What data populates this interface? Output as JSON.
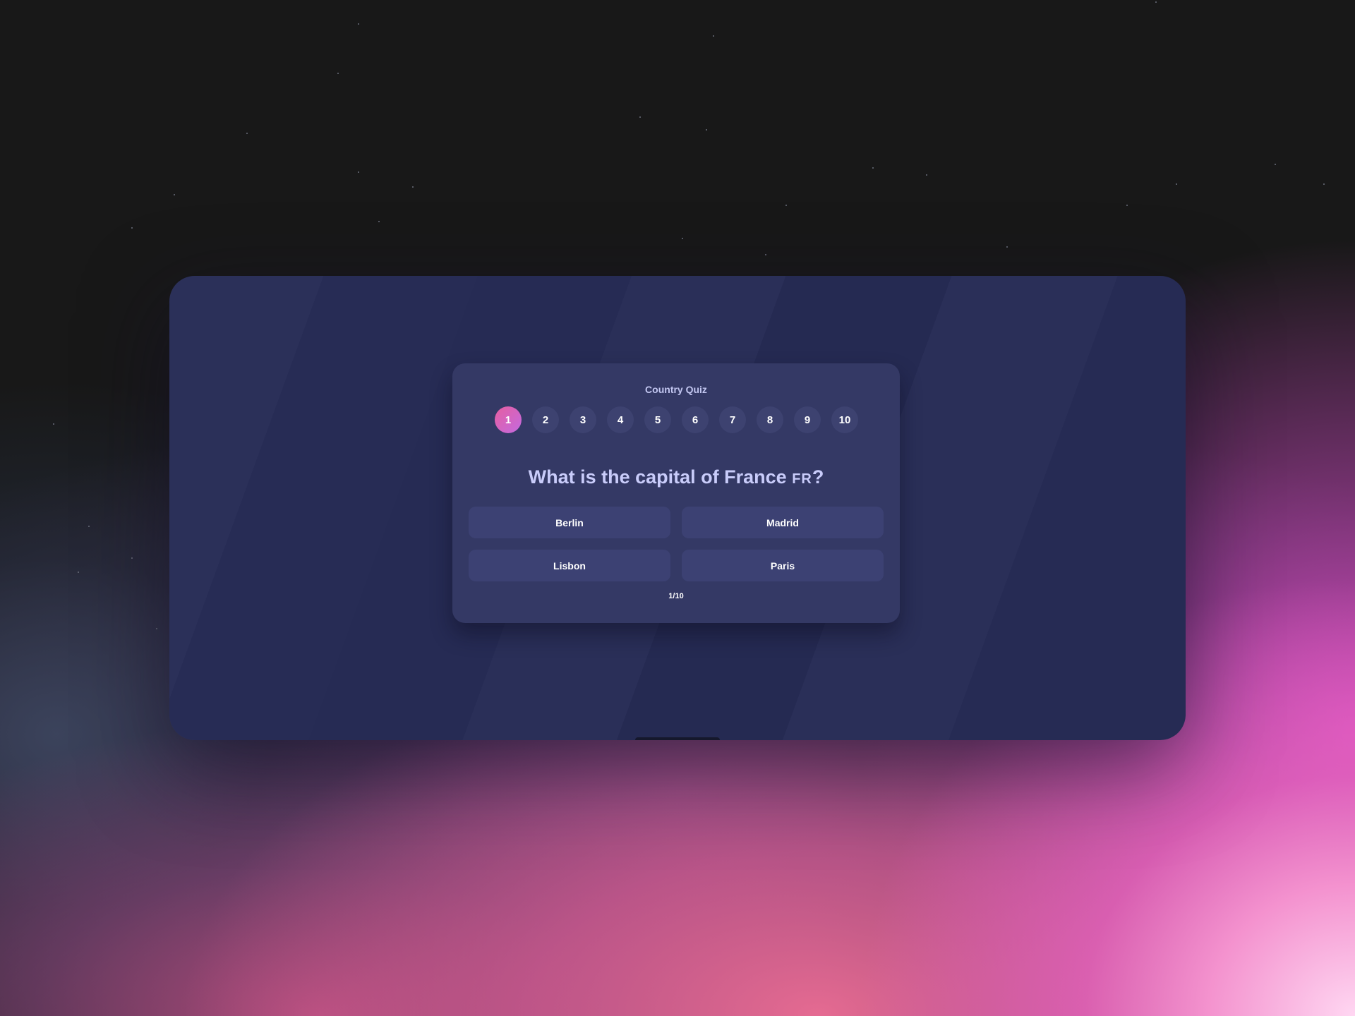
{
  "quiz": {
    "title": "Country Quiz",
    "steps": [
      "1",
      "2",
      "3",
      "4",
      "5",
      "6",
      "7",
      "8",
      "9",
      "10"
    ],
    "active_step": 1,
    "question_text": "What is the capital of France ",
    "question_flag": "FR",
    "question_mark": "?",
    "answers": [
      "Berlin",
      "Madrid",
      "Lisbon",
      "Paris"
    ],
    "progress": "1/10"
  },
  "colors": {
    "card": "#343965",
    "answer": "#3c4173",
    "active_step_gradient_start": "#e65ea0",
    "active_step_gradient_end": "#c36ae0",
    "title_text": "#c2c6f0"
  }
}
